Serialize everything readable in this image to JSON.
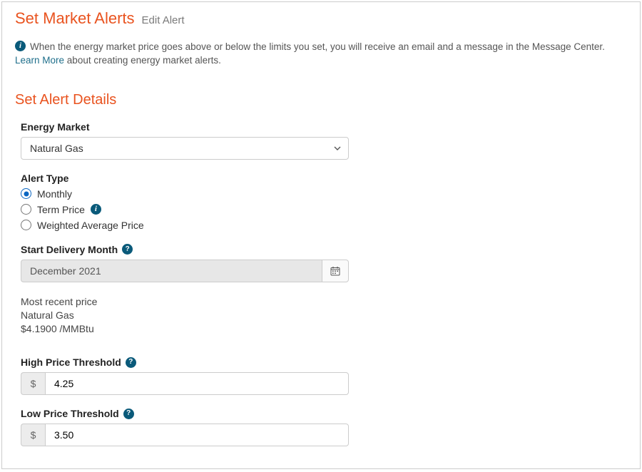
{
  "header": {
    "title": "Set Market Alerts",
    "subtitle": "Edit Alert"
  },
  "info": {
    "text": "When the energy market price goes above or below the limits you set, you will receive an email and a message in the Message Center.",
    "learn_more_label": "Learn More",
    "learn_more_suffix": " about creating energy market alerts."
  },
  "section_title": "Set Alert Details",
  "energy_market": {
    "label": "Energy Market",
    "selected": "Natural Gas"
  },
  "alert_type": {
    "label": "Alert Type",
    "options": [
      {
        "label": "Monthly",
        "checked": true,
        "has_info": false
      },
      {
        "label": "Term Price",
        "checked": false,
        "has_info": true
      },
      {
        "label": "Weighted Average Price",
        "checked": false,
        "has_info": false
      }
    ]
  },
  "start_delivery": {
    "label": "Start Delivery Month",
    "value": "December 2021"
  },
  "recent_price": {
    "label": "Most recent price",
    "commodity": "Natural Gas",
    "value": "$4.1900 /MMBtu"
  },
  "high_threshold": {
    "label": "High Price Threshold",
    "currency": "$",
    "value": "4.25"
  },
  "low_threshold": {
    "label": "Low Price Threshold",
    "currency": "$",
    "value": "3.50"
  }
}
